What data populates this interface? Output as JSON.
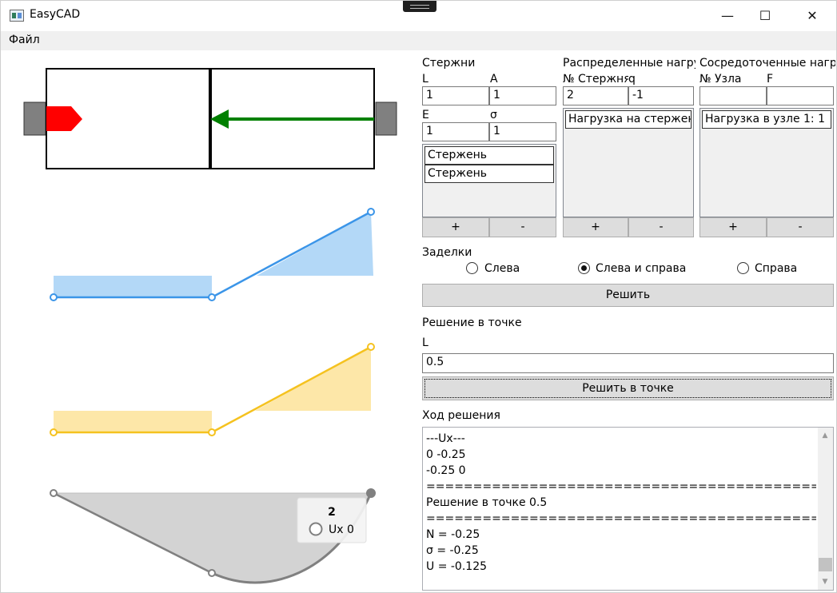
{
  "window": {
    "title": "EasyCAD",
    "min_glyph": "—",
    "max_glyph": "☐",
    "close_glyph": "✕"
  },
  "menu": {
    "file": "Файл"
  },
  "rods": {
    "title": "Стержни",
    "label_L": "L",
    "label_A": "A",
    "value_L": "1",
    "value_A": "1",
    "label_E": "E",
    "label_sigma": "σ",
    "value_E": "1",
    "value_sigma": "1",
    "items": [
      "Стержень",
      "Стержень"
    ],
    "add": "+",
    "remove": "-"
  },
  "distributed": {
    "title": "Распределенные нагрузки",
    "label_rod": "№ Стержня",
    "label_q": "q",
    "value_rod": "2",
    "value_q": "-1",
    "items": [
      "Нагрузка на стержень"
    ],
    "add": "+",
    "remove": "-"
  },
  "concentrated": {
    "title": "Сосредоточенные нагрузки",
    "label_node": "№ Узла",
    "label_F": "F",
    "value_node": "",
    "value_F": "",
    "items": [
      "Нагрузка в узле 1: 1"
    ],
    "add": "+",
    "remove": "-"
  },
  "supports": {
    "title": "Заделки",
    "left": "Слева",
    "both": "Слева и справа",
    "right": "Справа",
    "selected": "both"
  },
  "solve_button": "Решить",
  "point": {
    "title": "Решение в точке",
    "label_L": "L",
    "value_L": "0.5",
    "button": "Решить в точке"
  },
  "log": {
    "title": "Ход решения",
    "lines": [
      "---Ux---",
      "0 -0.25",
      "-0.25 0",
      "================================================================",
      "Решение в точке 0.5",
      "================================================================",
      "N = -0.25",
      "σ = -0.25",
      "U = -0.125"
    ]
  },
  "tooltip": {
    "title": "2",
    "series": "Ux",
    "value": "0"
  },
  "colors": {
    "left_support": "#808080",
    "node_force": "#ff0000",
    "distributed_arrow": "#008000",
    "plot_N": "#3b95e8",
    "plot_N_fill": "#b3d8f7",
    "plot_sigma": "#f5c21f",
    "plot_sigma_fill": "#fde7a8",
    "plot_U": "#808080",
    "plot_U_fill": "#d3d3d3"
  }
}
